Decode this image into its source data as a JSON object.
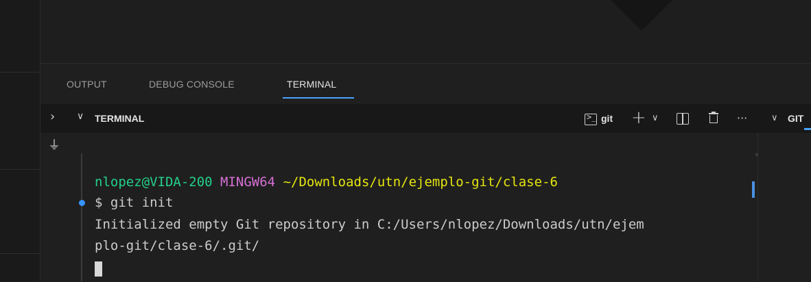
{
  "panel": {
    "tabs": [
      {
        "label": "OUTPUT"
      },
      {
        "label": "DEBUG CONSOLE"
      },
      {
        "label": "TERMINAL"
      }
    ]
  },
  "section": {
    "title": "TERMINAL",
    "profile": "git",
    "more": "···",
    "right_title": "GIT"
  },
  "terminal": {
    "prompt": {
      "user_host": "nlopez@VIDA-200",
      "system": "MINGW64",
      "path": "~/Downloads/utn/ejemplo-git/clase-6"
    },
    "command": "$ git init",
    "output_lines": [
      "Initialized empty Git repository in C:/Users/nlopez/Downloads/utn/ejem",
      "plo-git/clase-6/.git/"
    ]
  },
  "colors": {
    "user_host": "#23d18b",
    "system": "#d670d6",
    "path": "#e5e510",
    "text": "#cccccc",
    "accent": "#4aa3ff"
  },
  "icons": [
    "expand-icon",
    "chevron-down-icon",
    "plug-icon",
    "terminal-icon",
    "plus-icon",
    "split-icon",
    "trash-icon",
    "more-icon",
    "command-dot-icon"
  ]
}
